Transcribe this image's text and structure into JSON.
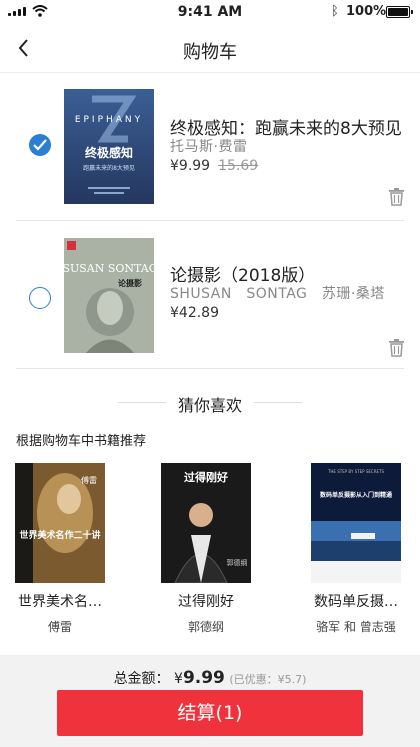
{
  "status_bar": {
    "time": "9:41 AM",
    "battery": "100%"
  },
  "nav": {
    "title": "购物车"
  },
  "cart_items": [
    {
      "name": "终极感知：跑赢未来的8大预见",
      "author": "托马斯·费雷",
      "price": "¥9.99",
      "original_price": "15.69",
      "selected": true,
      "cover": {
        "top_text": "EPIPHANY",
        "title": "终极感知",
        "subtitle": "跑赢未来的8大预见",
        "color": "#2c4a78"
      }
    },
    {
      "name": "论摄影（2018版）",
      "author": "SHUSAN　SONTAG　苏珊·桑塔",
      "price": "¥42.89",
      "selected": false,
      "cover": {
        "top_text": "SUSAN SONTAG",
        "title": "论摄影",
        "color": "#a9b1a5"
      }
    }
  ],
  "recommend": {
    "heading": "猜你喜欢",
    "subheading": "根据购物车中书籍推荐",
    "books": [
      {
        "title": "世界美术名…",
        "author": "傅雷",
        "cover_text": "世界美术名作二十讲",
        "cover_sub": "傅雷"
      },
      {
        "title": "过得刚好",
        "author": "郭德纲",
        "cover_text": "过得刚好",
        "cover_sub": "郭德纲"
      },
      {
        "title": "数码单反摄…",
        "author": "骆军 和 曾志强",
        "cover_text": "数码单反摄影从入门到精通",
        "cover_sub": "THE STEP BY STEP SECRETS"
      }
    ]
  },
  "summary": {
    "total_label": "总金额：",
    "currency": "¥",
    "total": "9.99",
    "discount": "(已优惠：¥5.7)",
    "checkout_label": "结算(1)"
  },
  "colors": {
    "accent": "#f0323c",
    "check": "#2b7fd3"
  }
}
